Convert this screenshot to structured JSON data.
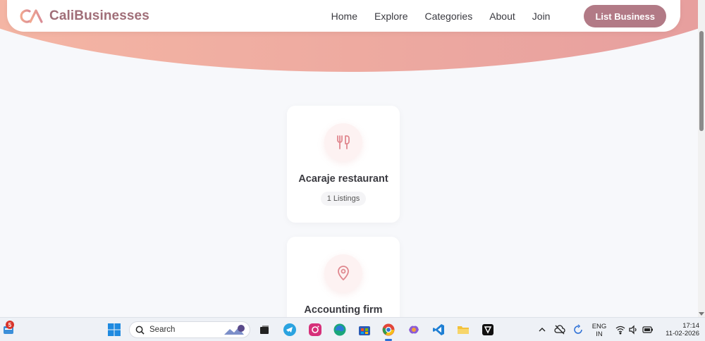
{
  "brand": {
    "name": "CaliBusinesses",
    "logo_icon": "ca-logo-icon",
    "color": "#a06e78"
  },
  "nav": {
    "links": [
      "Home",
      "Explore",
      "Categories",
      "About",
      "Join"
    ],
    "cta": "List Business",
    "cta_color": "#b27a86"
  },
  "categories": [
    {
      "title": "Acaraje restaurant",
      "listings": "1 Listings",
      "icon": "fork-knife-icon"
    },
    {
      "title": "Accounting firm",
      "listings": "",
      "icon": "map-pin-icon"
    }
  ],
  "taskbar": {
    "search_placeholder": "Search",
    "notification_count": "5",
    "language": "ENG",
    "region": "IN",
    "time": "17:14",
    "date": "11-02-2026"
  }
}
